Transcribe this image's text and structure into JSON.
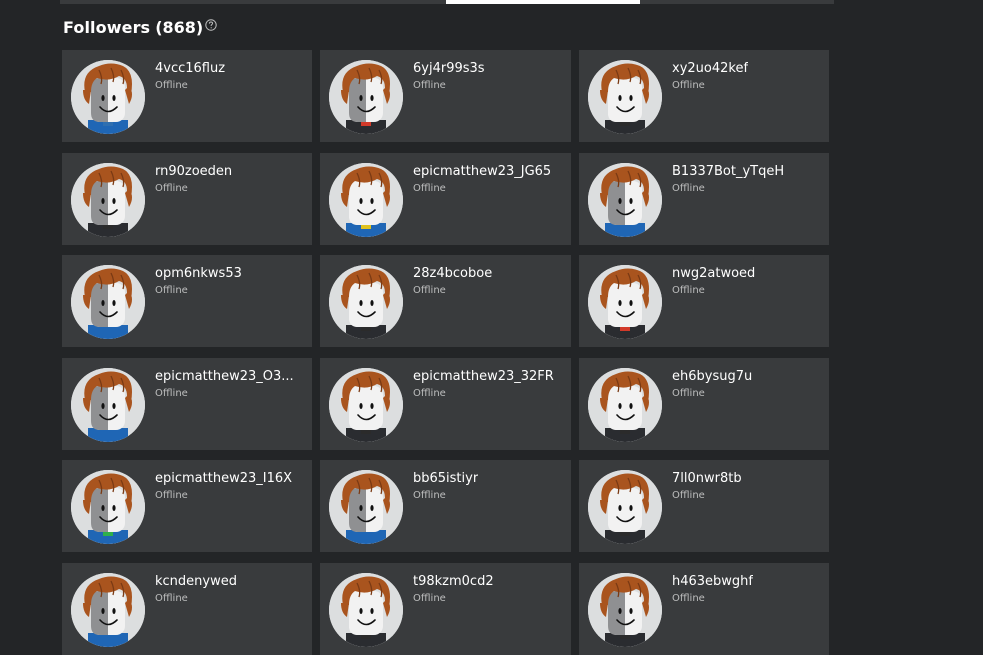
{
  "header": {
    "title": "Followers",
    "count": "(868)",
    "help_icon": "question-circle-icon"
  },
  "followers": [
    {
      "name": "4vcc16fluz",
      "status": "Offline",
      "shirt": "#1f66b5",
      "accent": "#2f6fb0"
    },
    {
      "name": "6yj4r99s3s",
      "status": "Offline",
      "shirt": "#2a2c30",
      "accent": "#d23a2a"
    },
    {
      "name": "xy2uo42kef",
      "status": "Offline",
      "shirt": "#2a2c30",
      "accent": "#2b2b2b"
    },
    {
      "name": "rn90zoeden",
      "status": "Offline",
      "shirt": "#2a2c30",
      "accent": "#2b2b2b"
    },
    {
      "name": "epicmatthew23_JG65",
      "status": "Offline",
      "shirt": "#1f66b5",
      "accent": "#e0c21f"
    },
    {
      "name": "B1337Bot_yTqeH",
      "status": "Offline",
      "shirt": "#1f66b5",
      "accent": "#1f66b5"
    },
    {
      "name": "opm6nkws53",
      "status": "Offline",
      "shirt": "#1f66b5",
      "accent": "#1f66b5"
    },
    {
      "name": "28z4bcoboe",
      "status": "Offline",
      "shirt": "#2a2c30",
      "accent": "#2b2b2b"
    },
    {
      "name": "nwg2atwoed",
      "status": "Offline",
      "shirt": "#2a2c30",
      "accent": "#d23a2a"
    },
    {
      "name": "epicmatthew23_O3...",
      "status": "Offline",
      "shirt": "#1f66b5",
      "accent": "#1f66b5"
    },
    {
      "name": "epicmatthew23_32FR",
      "status": "Offline",
      "shirt": "#2a2c30",
      "accent": "#2b2b2b"
    },
    {
      "name": "eh6bysug7u",
      "status": "Offline",
      "shirt": "#2a2c30",
      "accent": "#2b2b2b"
    },
    {
      "name": "epicmatthew23_I16X",
      "status": "Offline",
      "shirt": "#1f66b5",
      "accent": "#2fb04a"
    },
    {
      "name": "bb65istiyr",
      "status": "Offline",
      "shirt": "#1f66b5",
      "accent": "#1f66b5"
    },
    {
      "name": "7ll0nwr8tb",
      "status": "Offline",
      "shirt": "#2a2c30",
      "accent": "#2b2b2b"
    },
    {
      "name": "kcndenywed",
      "status": "Offline",
      "shirt": "#1f66b5",
      "accent": "#1f66b5"
    },
    {
      "name": "t98kzm0cd2",
      "status": "Offline",
      "shirt": "#2a2c30",
      "accent": "#2b2b2b"
    },
    {
      "name": "h463ebwghf",
      "status": "Offline",
      "shirt": "#2a2c30",
      "accent": "#2b2b2b"
    }
  ],
  "colors": {
    "background": "#232527",
    "card": "#393b3d",
    "status_text": "#bdbebe",
    "hair": "#a9541e",
    "skin": "#f2f2f2",
    "shaded_skin": "#8f9092"
  }
}
